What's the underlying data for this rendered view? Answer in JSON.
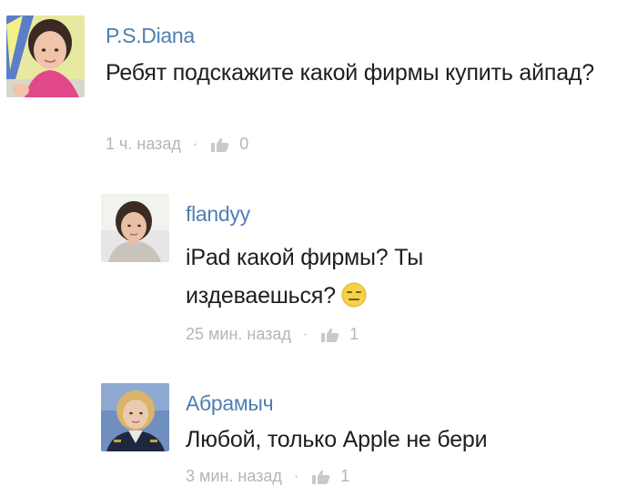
{
  "comments": [
    {
      "author": "P.S.Diana",
      "text": "Ребят подскажите какой фирмы купить айпад?",
      "time": "1 ч. назад",
      "likes": "0",
      "avatar_icon": "user-avatar-girl-pink-shirt"
    },
    {
      "author": "flandyy",
      "text": "iPad какой фирмы? Ты издеваешься?",
      "emoji": "expressionless-emoji",
      "time": "25 мин. назад",
      "likes": "1",
      "avatar_icon": "user-avatar-girl-dark-hair"
    },
    {
      "author": "Абрамыч",
      "text": "Любой, только Apple не бери",
      "time": "3 мин. назад",
      "likes": "1",
      "avatar_icon": "user-avatar-blonde-uniform"
    }
  ],
  "colors": {
    "author_link": "#4f7fb3",
    "body_text": "#1e1e1e",
    "meta_text": "#b5b5b5"
  }
}
